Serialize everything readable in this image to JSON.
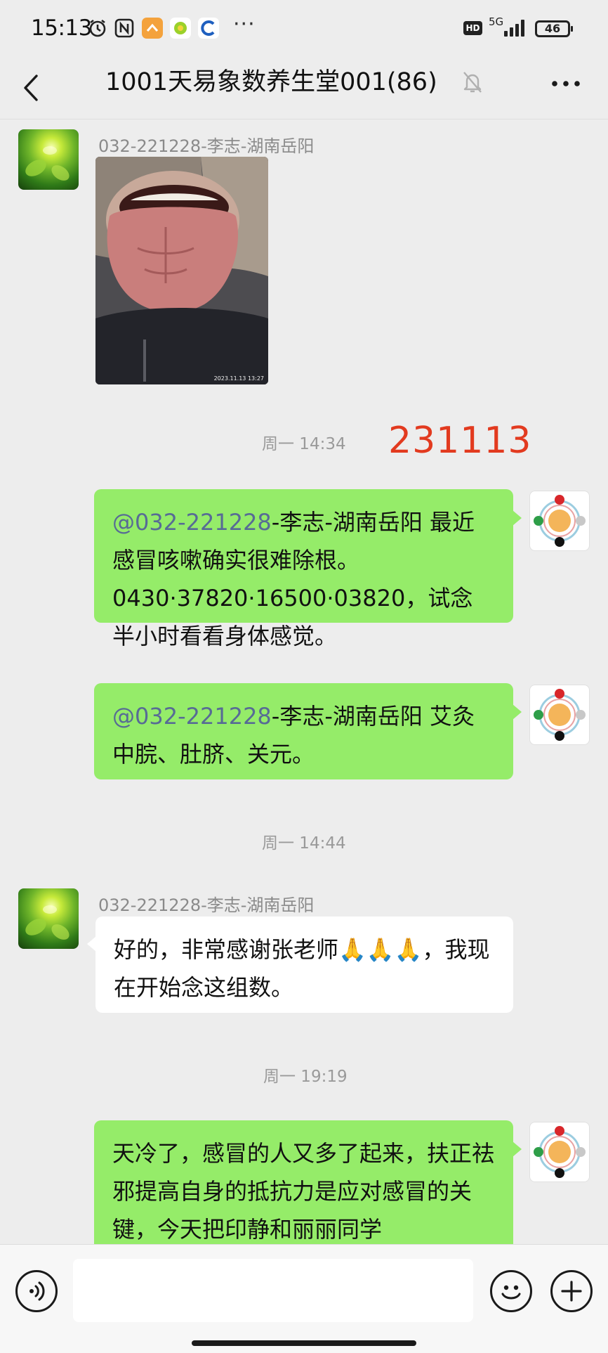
{
  "status_bar": {
    "time": "15:13",
    "network": "5G",
    "battery": "46",
    "hd_badge": "HD",
    "more": "···"
  },
  "header": {
    "title": "1001天易象数养生堂001(86)"
  },
  "messages": {
    "m1_sender": "032-221228-李志-湖南岳阳",
    "m1_photo_timestamp": "2023.11.13 13:27",
    "ts1": "周一 14:34",
    "date_annotation": "231113",
    "m2_mention": "@032-221228",
    "m2_text": "-李志-湖南岳阳  最近感冒咳嗽确实很难除根。0430·37820·16500·03820，试念半小时看看身体感觉。",
    "m3_mention": "@032-221228",
    "m3_text": "-李志-湖南岳阳  艾灸中脘、肚脐、关元。",
    "ts2": "周一 14:44",
    "m4_sender": "032-221228-李志-湖南岳阳",
    "m4_text_1": "好的，非常感谢张老师",
    "m4_emoji": "🙏🙏🙏",
    "m4_text_2": "，我现在开始念这组数。",
    "ts3": "周一 19:19",
    "m5_text": "天冷了，感冒的人又多了起来，扶正祛邪提高自身的抵抗力是应对感冒的关键，今天把印静和丽丽同学"
  },
  "input_bar": {
    "placeholder": ""
  },
  "colors": {
    "background": "#ededed",
    "bubble_green": "#95ec69",
    "bubble_white": "#ffffff",
    "mention_link": "#576b95",
    "annotation_red": "#e23a1f",
    "timestamp_gray": "#9a9a9a"
  },
  "icons": {
    "status_alarm": "alarm-clock-icon",
    "status_nfc": "nfc-icon",
    "status_app1": "orange-app-icon",
    "status_app2": "green-app-icon",
    "status_app3": "blue-app-icon",
    "back": "chevron-left-icon",
    "mute": "bell-off-icon",
    "more": "more-dots-icon",
    "voice": "voice-icon",
    "emoji": "smiley-icon",
    "add": "plus-icon"
  }
}
